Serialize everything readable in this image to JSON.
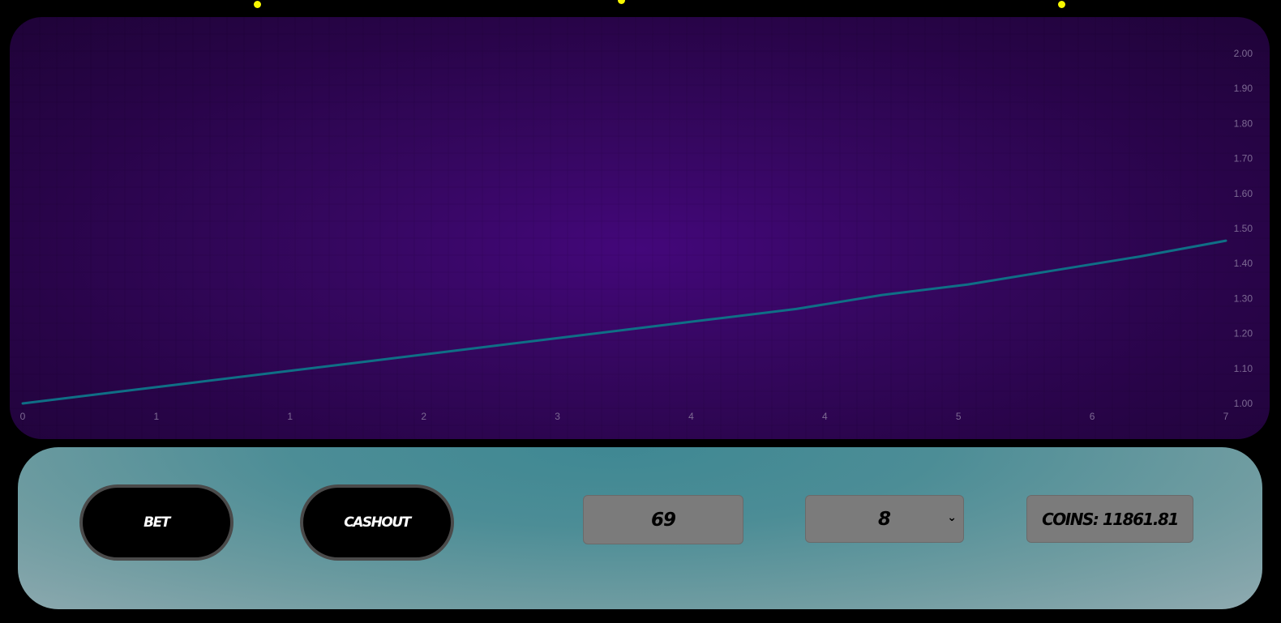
{
  "chart_data": {
    "type": "line",
    "x_tick_labels": [
      "0",
      "1",
      "1",
      "2",
      "3",
      "4",
      "4",
      "5",
      "6",
      "7"
    ],
    "y_tick_labels": [
      "1.00",
      "1.10",
      "1.20",
      "1.30",
      "1.40",
      "1.50",
      "1.60",
      "1.70",
      "1.80",
      "1.90",
      "2.00"
    ],
    "xlim": [
      0,
      7
    ],
    "ylim": [
      1.0,
      2.0
    ],
    "grid": true,
    "series": [
      {
        "color": "#0f6f86",
        "x": [
          0,
          0.5,
          1,
          1.5,
          2,
          2.5,
          3,
          3.5,
          4,
          4.5,
          5,
          5.5,
          6,
          6.5,
          7
        ],
        "values": [
          1.0,
          1.03,
          1.06,
          1.09,
          1.12,
          1.15,
          1.18,
          1.21,
          1.24,
          1.27,
          1.31,
          1.34,
          1.38,
          1.42,
          1.465
        ]
      }
    ]
  },
  "controls": {
    "bet_label": "BET",
    "cashout_label": "CASHOUT",
    "bet_amount_value": "69",
    "multiplier_value": "8",
    "coins_label": "COINS: 11861.81"
  },
  "colors": {
    "dot": "#f7f700",
    "chart_line": "#0f6f86",
    "tick_label": "#7d6a93"
  }
}
